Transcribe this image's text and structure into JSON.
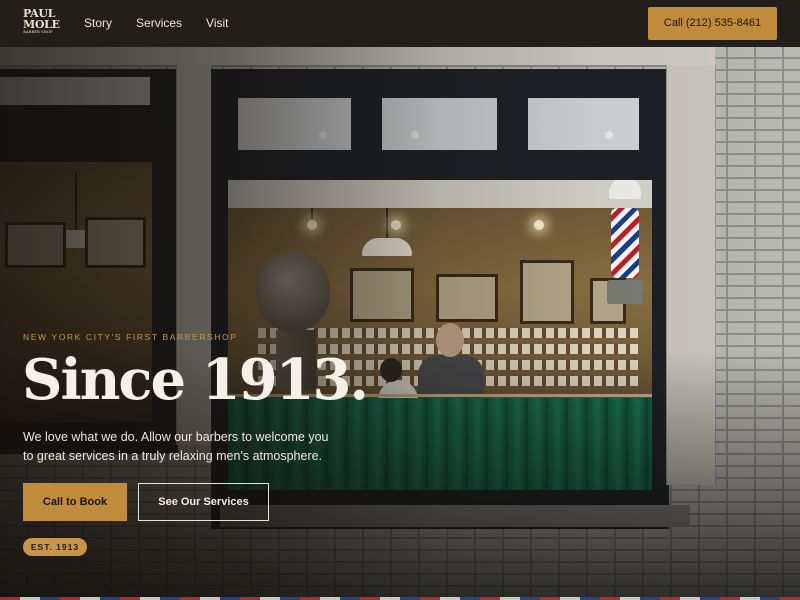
{
  "brand": {
    "logo_line1": "PAUL",
    "logo_line2": "MOLE",
    "logo_line3": "BARBER SHOP"
  },
  "nav": {
    "links": [
      "Story",
      "Services",
      "Visit"
    ],
    "call_label": "Call (212) 535-8461"
  },
  "hero": {
    "eyebrow": "NEW YORK CITY'S FIRST BARBERSHOP",
    "headline": "Since 1913.",
    "body": "We love what we do. Allow our barbers to welcome you to great services in a truly relaxing men's atmosphere.",
    "primary_button": "Call to Book",
    "secondary_button": "See Our Services",
    "badge": "EST. 1913"
  },
  "colors": {
    "accent": "#c08c3c",
    "nav_background": "#221e19",
    "headline_text": "#f6f1e6"
  }
}
